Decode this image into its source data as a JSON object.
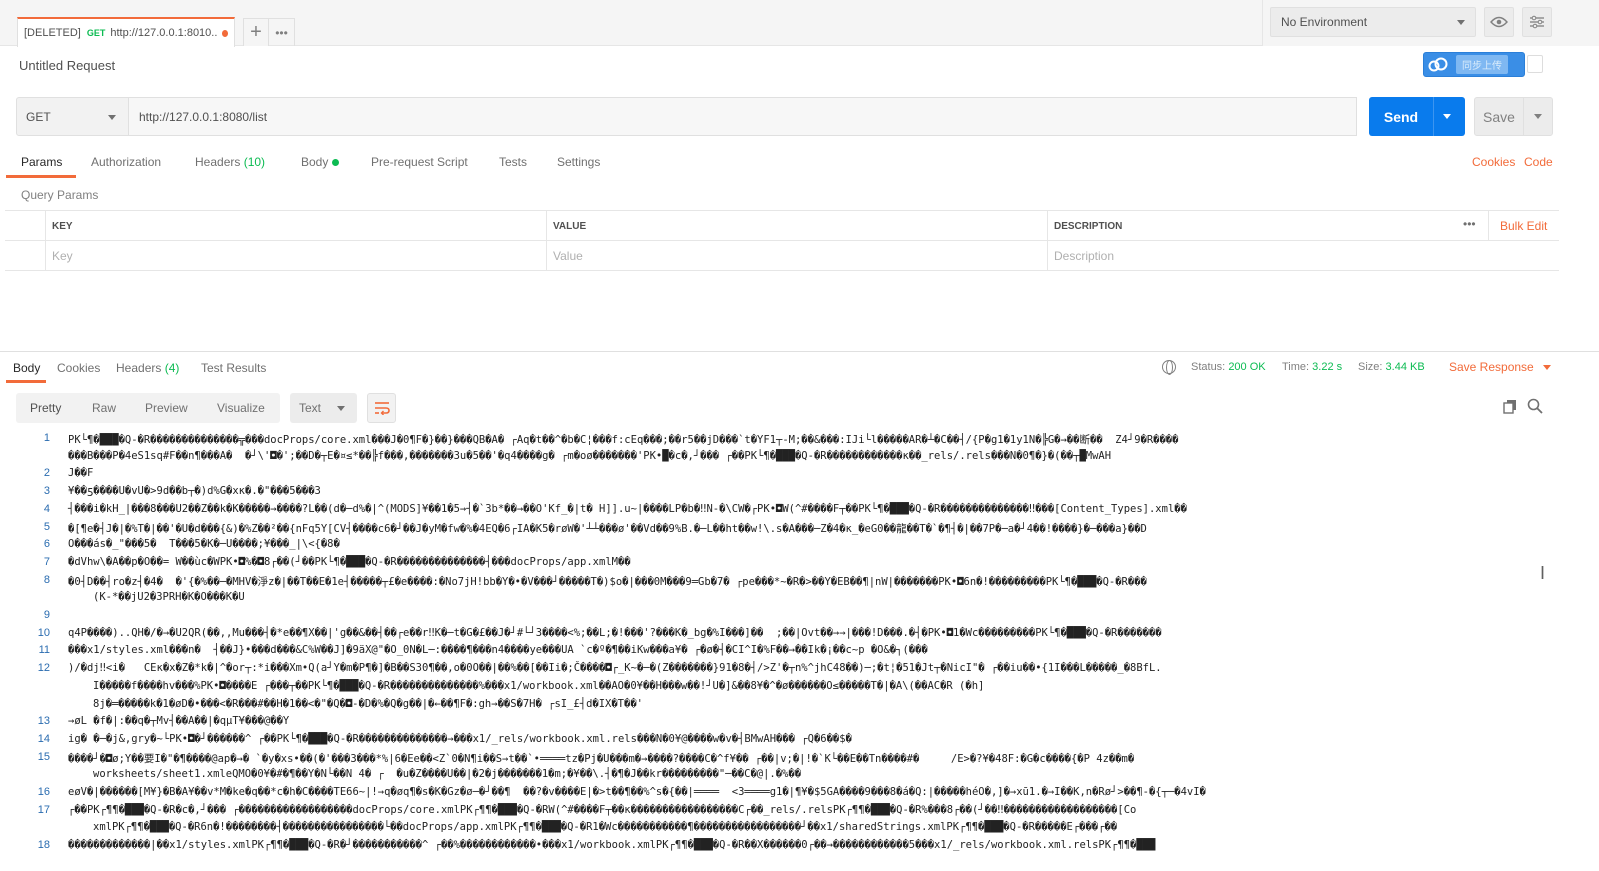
{
  "tab": {
    "deleted_label": "[DELETED]",
    "method": "GET",
    "url": "http://127.0.0.1:8010..."
  },
  "environment": {
    "selected": "No Environment"
  },
  "request": {
    "title": "Untitled Request",
    "method": "GET",
    "url": "http://127.0.0.1:8080/list",
    "send_label": "Send",
    "save_label": "Save",
    "cloud_label": "同步上传"
  },
  "request_tabs": {
    "params": "Params",
    "authorization": "Authorization",
    "headers": "Headers",
    "headers_count": "(10)",
    "body": "Body",
    "prerequest": "Pre-request Script",
    "tests": "Tests",
    "settings": "Settings",
    "cookies": "Cookies",
    "code": "Code"
  },
  "query_params": {
    "label": "Query Params",
    "col_key": "KEY",
    "col_value": "VALUE",
    "col_description": "DESCRIPTION",
    "more": "•••",
    "bulk_edit": "Bulk Edit",
    "ph_key": "Key",
    "ph_value": "Value",
    "ph_description": "Description"
  },
  "response": {
    "tabs": {
      "body": "Body",
      "cookies": "Cookies",
      "headers": "Headers",
      "headers_count": "(4)",
      "tests": "Test Results"
    },
    "status_label": "Status:",
    "status_value": "200 OK",
    "time_label": "Time:",
    "time_value": "3.22 s",
    "size_label": "Size:",
    "size_value": "3.44 KB",
    "save_label": "Save Response",
    "formats": {
      "pretty": "Pretty",
      "raw": "Raw",
      "preview": "Preview",
      "visualize": "Visualize"
    },
    "type": "Text"
  },
  "body_lines": [
    {
      "n": "1",
      "t": "PK└¶�███�Q-�R��������������╦���docProps/core.xml���J�0¶F�}��}���QB�A� ┌Aq�t��^�b�C¦���f:cEq���;��r5��jD���`t�YF1┬-M;��&���:IJi└l�����AR�┴�C��┤/{P�g1�1y1N�╠G�→��断��  Z4┘9�R����"
    },
    {
      "n": "",
      "t": "���B���P�4eS1sq#F��n¶���A�  �┘\\'◘�';��D�┬E�¤≤*��╠f���,�������3u�5��'�q4����g� ┌m�oø�������'PK•█�c�,┘��� ┌��PK└¶�███�Q-�R������������ĸ��_rels/.rels���N�0¶�}�(��┬█MwAH"
    },
    {
      "n": "2",
      "t": "J��F"
    },
    {
      "n": "3",
      "t": "¥��ƽ����U�vU�>9d��b┬�)d%G�xĸ�.�\"���5���3"
    },
    {
      "n": "4",
      "t": "┤���i�kH_|���8���U2��Z��k�K�����→����?L��(d�─d%�|^(MODS]¥��1�5→┤�`3b*��→��O'Kf_�|t� H]].u~|����LP�b�‼N-�\\CW�┌PK•◘W(^#����F┬��PK└¶�███�Q-�R��������������‼���[Content_Types].xml��"
    },
    {
      "n": "5",
      "t": "�[¶e�┤J�|�%T�|��'�U�d���{&)�%Z��²��{nFq5Y[CV┤����c6�┘��J�yM�fw�%�4EQ�6┌IA�K5�røW�'┴┴���ø'��Vd��9%B.�─L��ht��w!\\.s�A���─Z�4�ĸ_�eG0��龍��T�`�¶┤�|��7P�─a�┘4��!����}�─���a}��D"
    },
    {
      "n": "6",
      "t": "O���ás�_\"���5�  T���5�K�─U����;¥���_|\\<{�8�"
    },
    {
      "n": "7",
      "t": "�dVhw\\�A��p�O��= W��ùc�WPK•◘%�◘8┌��(┘��PK└¶�███�Q-�R��������������┤���docProps/app.xmlM��"
    },
    {
      "n": "8",
      "t": "�0┤D��┤ro�z┤�4�  �'{�%��─�MHV�淨z�|��T��E�1e┤�����┬£�e����:�No7jH!bb�Y�•�V���┘�����T�)$o�|���0M���9═Gb�7� ┌pe���*~�R�>��Y�EB��¶|nW|�������PK•◘6n�!���������PK└¶�███�Q-�R���"
    },
    {
      "n": "",
      "t": "(K-*��jU2�3PRH�K�O���K�U",
      "indent": true
    },
    {
      "n": "9",
      "t": ""
    },
    {
      "n": "10",
      "t": "q4P����)..QH�/�→�U2QR(��,,Mu���┤�*e��¶X��|'g��&��┤��┌e��r‼K�─t�G�£��J�┘#└┘3����<%;��L;�!���'?���K�_bg�%I���]��  ;��|Ovt��→→|���!D���.�┤�PK•◘1�Wc���������PK└¶�███�Q-�R�������"
    },
    {
      "n": "11",
      "t": "���x1/styles.xml���n�  ┤��J}•���d���&C%W��J]�9äX@\"�O_0N�L─:����¶���n4����ye���UA `c�º�¶��iKw���a¥� ┌�ø�┤�CI^I�%F��→��Ik�¡��c~p �O&�┐(���"
    },
    {
      "n": "12",
      "t": ")/�dj‼<i�   CEĸ�x�Z�*k�|^�or┬:*i���Xm•Q(a┘Y�m�P¶�]�B��S30¶��,o�0O��|��%��[��Ii�;Č����◘┌_K~�─�(Z�������}91�8�┤/>Z'�┬n%^jhC48��)─;�t¦�51�Jt┬�NicI\"� ┌��iu��•{1I���L�����_�8BfL."
    },
    {
      "n": "",
      "t": "I�����f����hv���%PK•◘����E ┌���┬��PK└¶�███�Q-�R��������������%���x1/workbook.xml��AO�0¥��H���w��!┘U�]&��8¥�^�ø������O≤�����T�|�A\\(��AC�R (�h]",
      "indent": true
    },
    {
      "n": "",
      "t": "8j�═�����k�1�øD�•���<�R���#��H�1��<�\"�Q�◘-�D�%�Q�g��|�←��¶F�:gh→��S�7H� ┌sI_£┤d�IX�T��'",
      "indent": true
    },
    {
      "n": "13",
      "t": "→øL �f�|:��q�┬Mv┤��A��|�qµT¥���@��Y"
    },
    {
      "n": "14",
      "t": "ig� �─�j&,gry�~└PK•◘�┘������^ ┌��PK└¶�███�Q-�R��������������→���x1/_rels/workbook.xml.rels���N�0¥@����w�v�┤BMwAH��� ┌Q�6��$�"
    },
    {
      "n": "15",
      "t": "����┘�◘ø;Y��要I�\"�¶����@ap�→� `�y�xs•��(�'���3���*%|6�Ee��<Z`0�N¶i��S→t��`•════tz�Pj�U���m�→����?����C�^f¥�� ┌��|v;�|!�`K└��E��Tn����#�     /E>�?¥�48F:�G�c����{�P 4z��m�"
    },
    {
      "n": "",
      "t": "worksheets/sheet1.xmleQMO�0¥�#�¶��Y�N└��N 4� ┌  �u�Z����U��|�2�j�������1�m;�¥��\\.┤�¶�J��kr���������\"─��C�@|.�%��",
      "indent": true
    },
    {
      "n": "16",
      "t": "eøV�|������[M¥}�B�A¥��v*M�ke�q��*c�h�C����TE66~|!→q�øq¶�s�K�Gz�ø─�┘��¶  ��?�v����E|�>t��¶��%^s�{��|════  <3════g1�|¶¥�$5GA����9���8�á�Q:|�����héO�,]�→xū1.�→I��K,n�Rø┘>��¶-�{┬─�4vI�"
    },
    {
      "n": "17",
      "t": "┌��PK┌¶¶�███�Q-�R�c�,┘��� ┌������������������docProps/core.xmlPK┌¶¶�███�Q-�RW(^#����F┬��ĸ�����������������C┌��_rels/.relsPK┌¶¶�███�Q-�R%���8┌��(┘��‼������������������[Co"
    },
    {
      "n": "",
      "t": "xmlPK┌¶¶�███�Q-�R6n�!��������┤����������������└��docProps/app.xmlPK┌¶¶�███�Q-�R1�Wc�����������¶�����������������┘��x1/sharedStrings.xmlPK┌¶¶�███�Q-�R�����E┌���┌��",
      "indent": true
    },
    {
      "n": "18",
      "t": "�������������|��x1/styles.xmlPK┌¶¶�███�Q-�R�┘�����������^ ┌��%������������•���x1/workbook.xmlPK┌¶¶�███�Q-�R��X������0┌��→������������5���x1/_rels/workbook.xml.relsPK┌¶¶�███"
    }
  ],
  "colors": {
    "accent": "#f26b3a",
    "send_blue": "#097bed",
    "ok_green": "#0cbb52"
  }
}
